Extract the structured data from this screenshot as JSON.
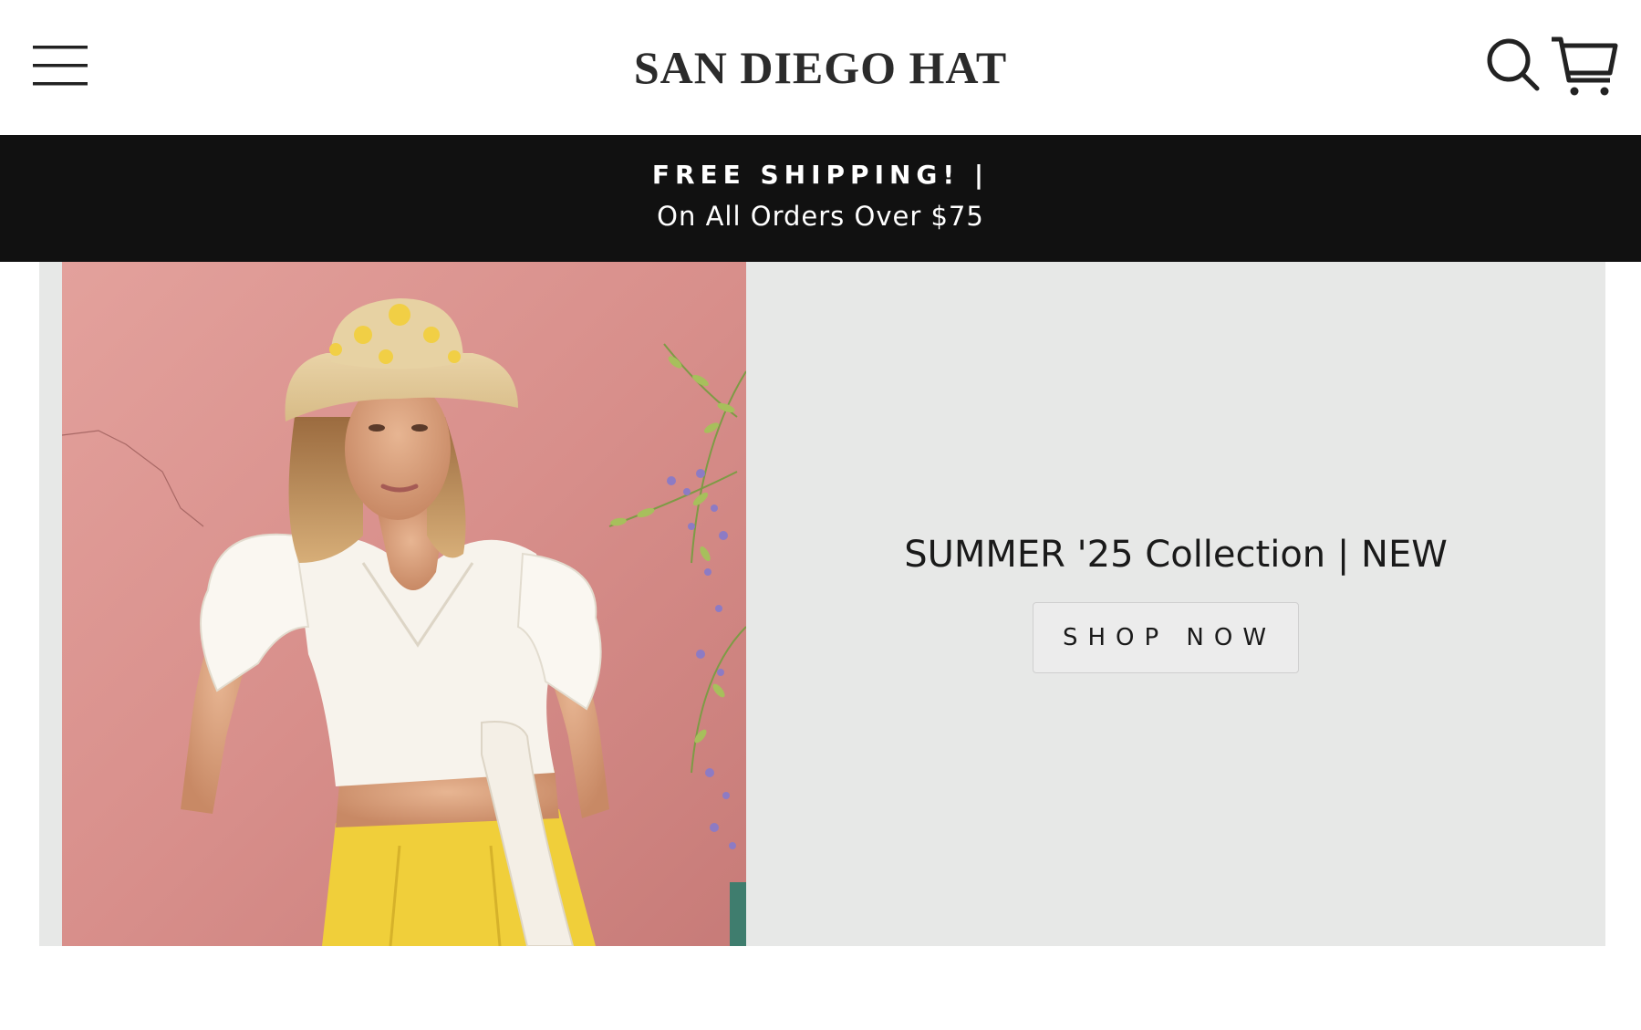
{
  "header": {
    "logo_text": "SAN DIEGO HAT",
    "menu_icon": "hamburger-menu-icon",
    "search_icon": "search-icon",
    "cart_icon": "cart-icon"
  },
  "announcement": {
    "title": "FREE SHIPPING!  |",
    "subtitle": "On All Orders Over $75"
  },
  "hero": {
    "image_description_icon": "hero-photo",
    "heading": "SUMMER '25 Collection | NEW",
    "button_label": "SHOP NOW"
  },
  "colors": {
    "announcement_bg": "#111111",
    "hero_bg": "#e7e8e7",
    "photo_wall": "#d98f8c",
    "skirt_yellow": "#f0cf3a"
  }
}
